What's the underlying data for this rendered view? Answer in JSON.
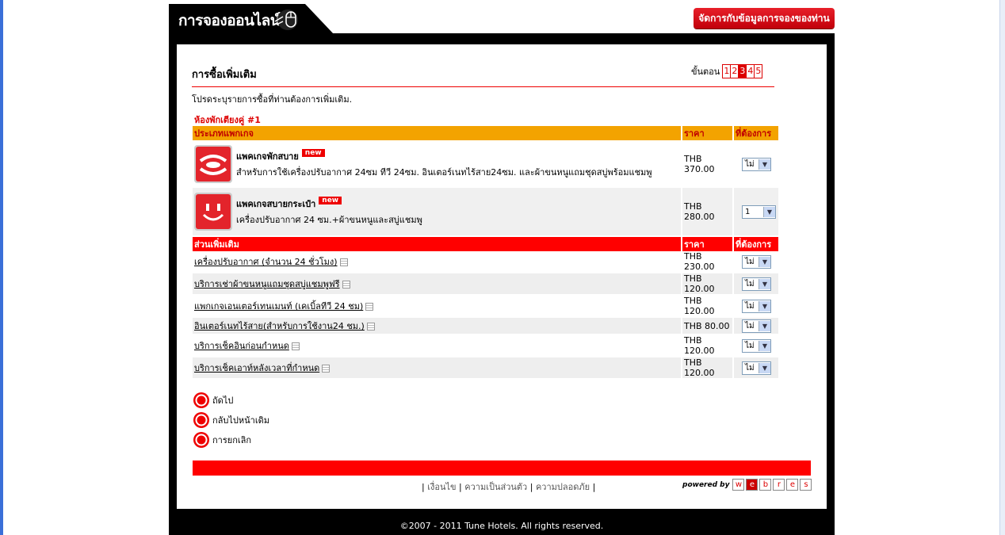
{
  "header": {
    "title": "การจองออนไลน์",
    "manage_button": "จัดการกับข้อมูลการจองของท่าน"
  },
  "page": {
    "heading": "การซื้อเพิ่มเติม",
    "steps_label": "ขั้นตอน",
    "steps": [
      "1",
      "2",
      "3",
      "4",
      "5"
    ],
    "current_step": "3",
    "instruction": "โปรดระบุรายการซื้อที่ท่านต้องการเพิ่มเติม."
  },
  "room_label": "ห้องพักเตียงคู่ #1",
  "packages": {
    "headers": {
      "type": "ประเภทแพกเกจ",
      "price": "ราคา",
      "want": "ที่ต้องการ"
    },
    "items": [
      {
        "name": "แพคเกจพักสบาย",
        "badge": "new",
        "desc": "สำหรับการใช้เครื่องปรับอากาศ 24ซม ทีวี 24ซม. อินเตอร์เนทไร้สาย24ซม. และผ้าขนหนูแถมชุดสบู่พร้อมแชมพู",
        "price": "THB 370.00",
        "selected": "ไม่"
      },
      {
        "name": "แพคเกจสบายกระเป๋า",
        "badge": "new",
        "desc": "เครื่องปรับอากาศ 24 ซม.+ผ้าขนหนูและสบู่แชมพู",
        "price": "THB 280.00",
        "selected": "1"
      }
    ]
  },
  "addons": {
    "headers": {
      "type": "ส่วนเพิ่มเติม",
      "price": "ราคา",
      "want": "ที่ต้องการ"
    },
    "items": [
      {
        "name": "เครื่องปรับอากาศ (จำนวน 24 ชั่วโมง)",
        "price": "THB 230.00",
        "selected": "ไม่"
      },
      {
        "name": "บริการเช่าผ้าขนหนูแถมชุดสบู่แชมพูฟรี",
        "price": "THB 120.00",
        "selected": "ไม่"
      },
      {
        "name": "แพกเกจเอนเตอร์เทนเมนท์ (เคเบิ้ลทีวี 24 ชม)",
        "price": "THB 120.00",
        "selected": "ไม่"
      },
      {
        "name": "อินเตอร์เนทไร้สาย(สำหรับการใช้งาน24 ชม.)",
        "price": "THB 80.00",
        "selected": "ไม่"
      },
      {
        "name": "บริการเช็คอินก่อนกำหนด",
        "price": "THB 120.00",
        "selected": "ไม่"
      },
      {
        "name": "บริการเช็คเอาท์หลังเวลาที่กำหนด",
        "price": "THB 120.00",
        "selected": "ไม่"
      }
    ]
  },
  "nav": {
    "next": "ถัดไป",
    "back": "กลับไปหน้าเดิม",
    "cancel": "การยกเลิก"
  },
  "footer": {
    "links": [
      "เงื่อนไข",
      "ความเป็นส่วนตัว",
      "ความปลอดภัย"
    ],
    "powered_by": "powered by",
    "logo_letters": [
      "w",
      "e",
      "b",
      "r",
      "e",
      "s"
    ],
    "copyright": "©2007 - 2011 Tune Hotels. All rights reserved."
  },
  "colors": {
    "brand_red": "#ff0000",
    "header_orange": "#f3a300",
    "frame": "#000000"
  }
}
